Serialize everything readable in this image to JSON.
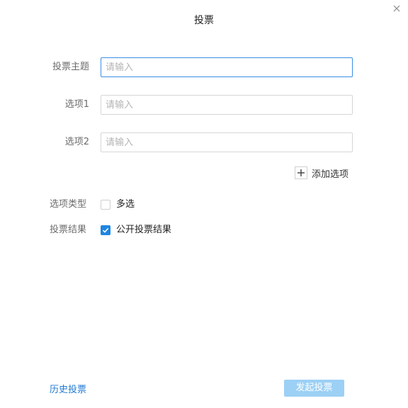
{
  "dialog": {
    "title": "投票",
    "close_icon": "close-icon"
  },
  "form": {
    "topic": {
      "label": "投票主题",
      "placeholder": "请输入",
      "value": ""
    },
    "options": [
      {
        "label": "选项1",
        "placeholder": "请输入",
        "value": ""
      },
      {
        "label": "选项2",
        "placeholder": "请输入",
        "value": ""
      }
    ],
    "add_option_label": "添加选项",
    "add_option_icon": "plus-icon",
    "option_type": {
      "label": "选项类型",
      "checkbox_text": "多选",
      "checked": false
    },
    "result": {
      "label": "投票结果",
      "checkbox_text": "公开投票结果",
      "checked": true
    }
  },
  "footer": {
    "history_link": "历史投票",
    "submit_label": "发起投票",
    "submit_enabled": false
  },
  "colors": {
    "accent": "#1f86e0",
    "link": "#1f7ad4",
    "submit_disabled_bg": "#9cd0f5",
    "focus_border": "#3a8ee6"
  }
}
